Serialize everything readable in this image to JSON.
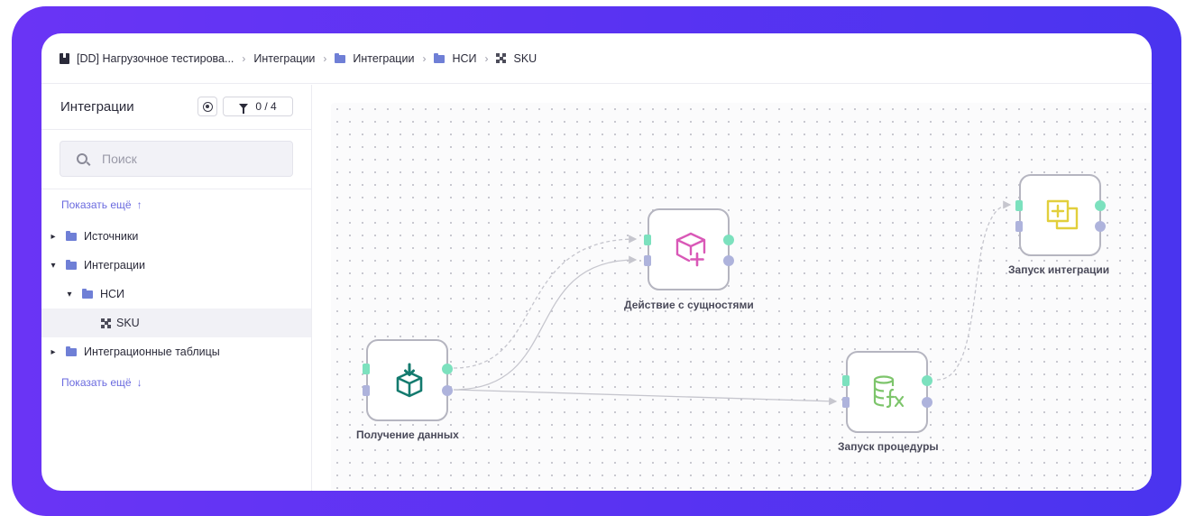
{
  "breadcrumb": {
    "items": [
      {
        "icon": "book-icon",
        "label": "[DD] Нагрузочное тестирова..."
      },
      {
        "icon": "",
        "label": "Интеграции"
      },
      {
        "icon": "folder-icon",
        "label": "Интеграции"
      },
      {
        "icon": "folder-icon",
        "label": "НСИ"
      },
      {
        "icon": "grid-icon",
        "label": "SKU"
      }
    ]
  },
  "sidebar": {
    "title": "Интеграции",
    "filter_label": "0 / 4",
    "search_placeholder": "Поиск",
    "show_more_top": "Показать ещё",
    "show_more_bottom": "Показать ещё",
    "tree": [
      {
        "label": "Источники",
        "chevron": "›",
        "type": "folder"
      },
      {
        "label": "Интеграции",
        "chevron": "⌄",
        "type": "folder"
      },
      {
        "label": "НСИ",
        "chevron": "⌄",
        "type": "folder"
      },
      {
        "label": "SKU",
        "chevron": "",
        "type": "item",
        "selected": true
      },
      {
        "label": "Интеграционные таблицы",
        "chevron": "›",
        "type": "folder"
      }
    ]
  },
  "canvas": {
    "nodes": [
      {
        "label": "Получение данных",
        "icon": "package-download-icon",
        "icon_color": "#137a6e"
      },
      {
        "label": "Действие с сущностями",
        "icon": "cube-plus-icon",
        "icon_color": "#d958b7"
      },
      {
        "label": "Запуск процедуры",
        "icon": "database-function-icon",
        "icon_color": "#7dc56b"
      },
      {
        "label": "Запуск интеграции",
        "icon": "add-integration-icon",
        "icon_color": "#e2cf3c"
      }
    ],
    "colors": {
      "port_ok": "#7ce1be",
      "port_default": "#aeb3dc",
      "edge": "#c6c6ce"
    }
  }
}
